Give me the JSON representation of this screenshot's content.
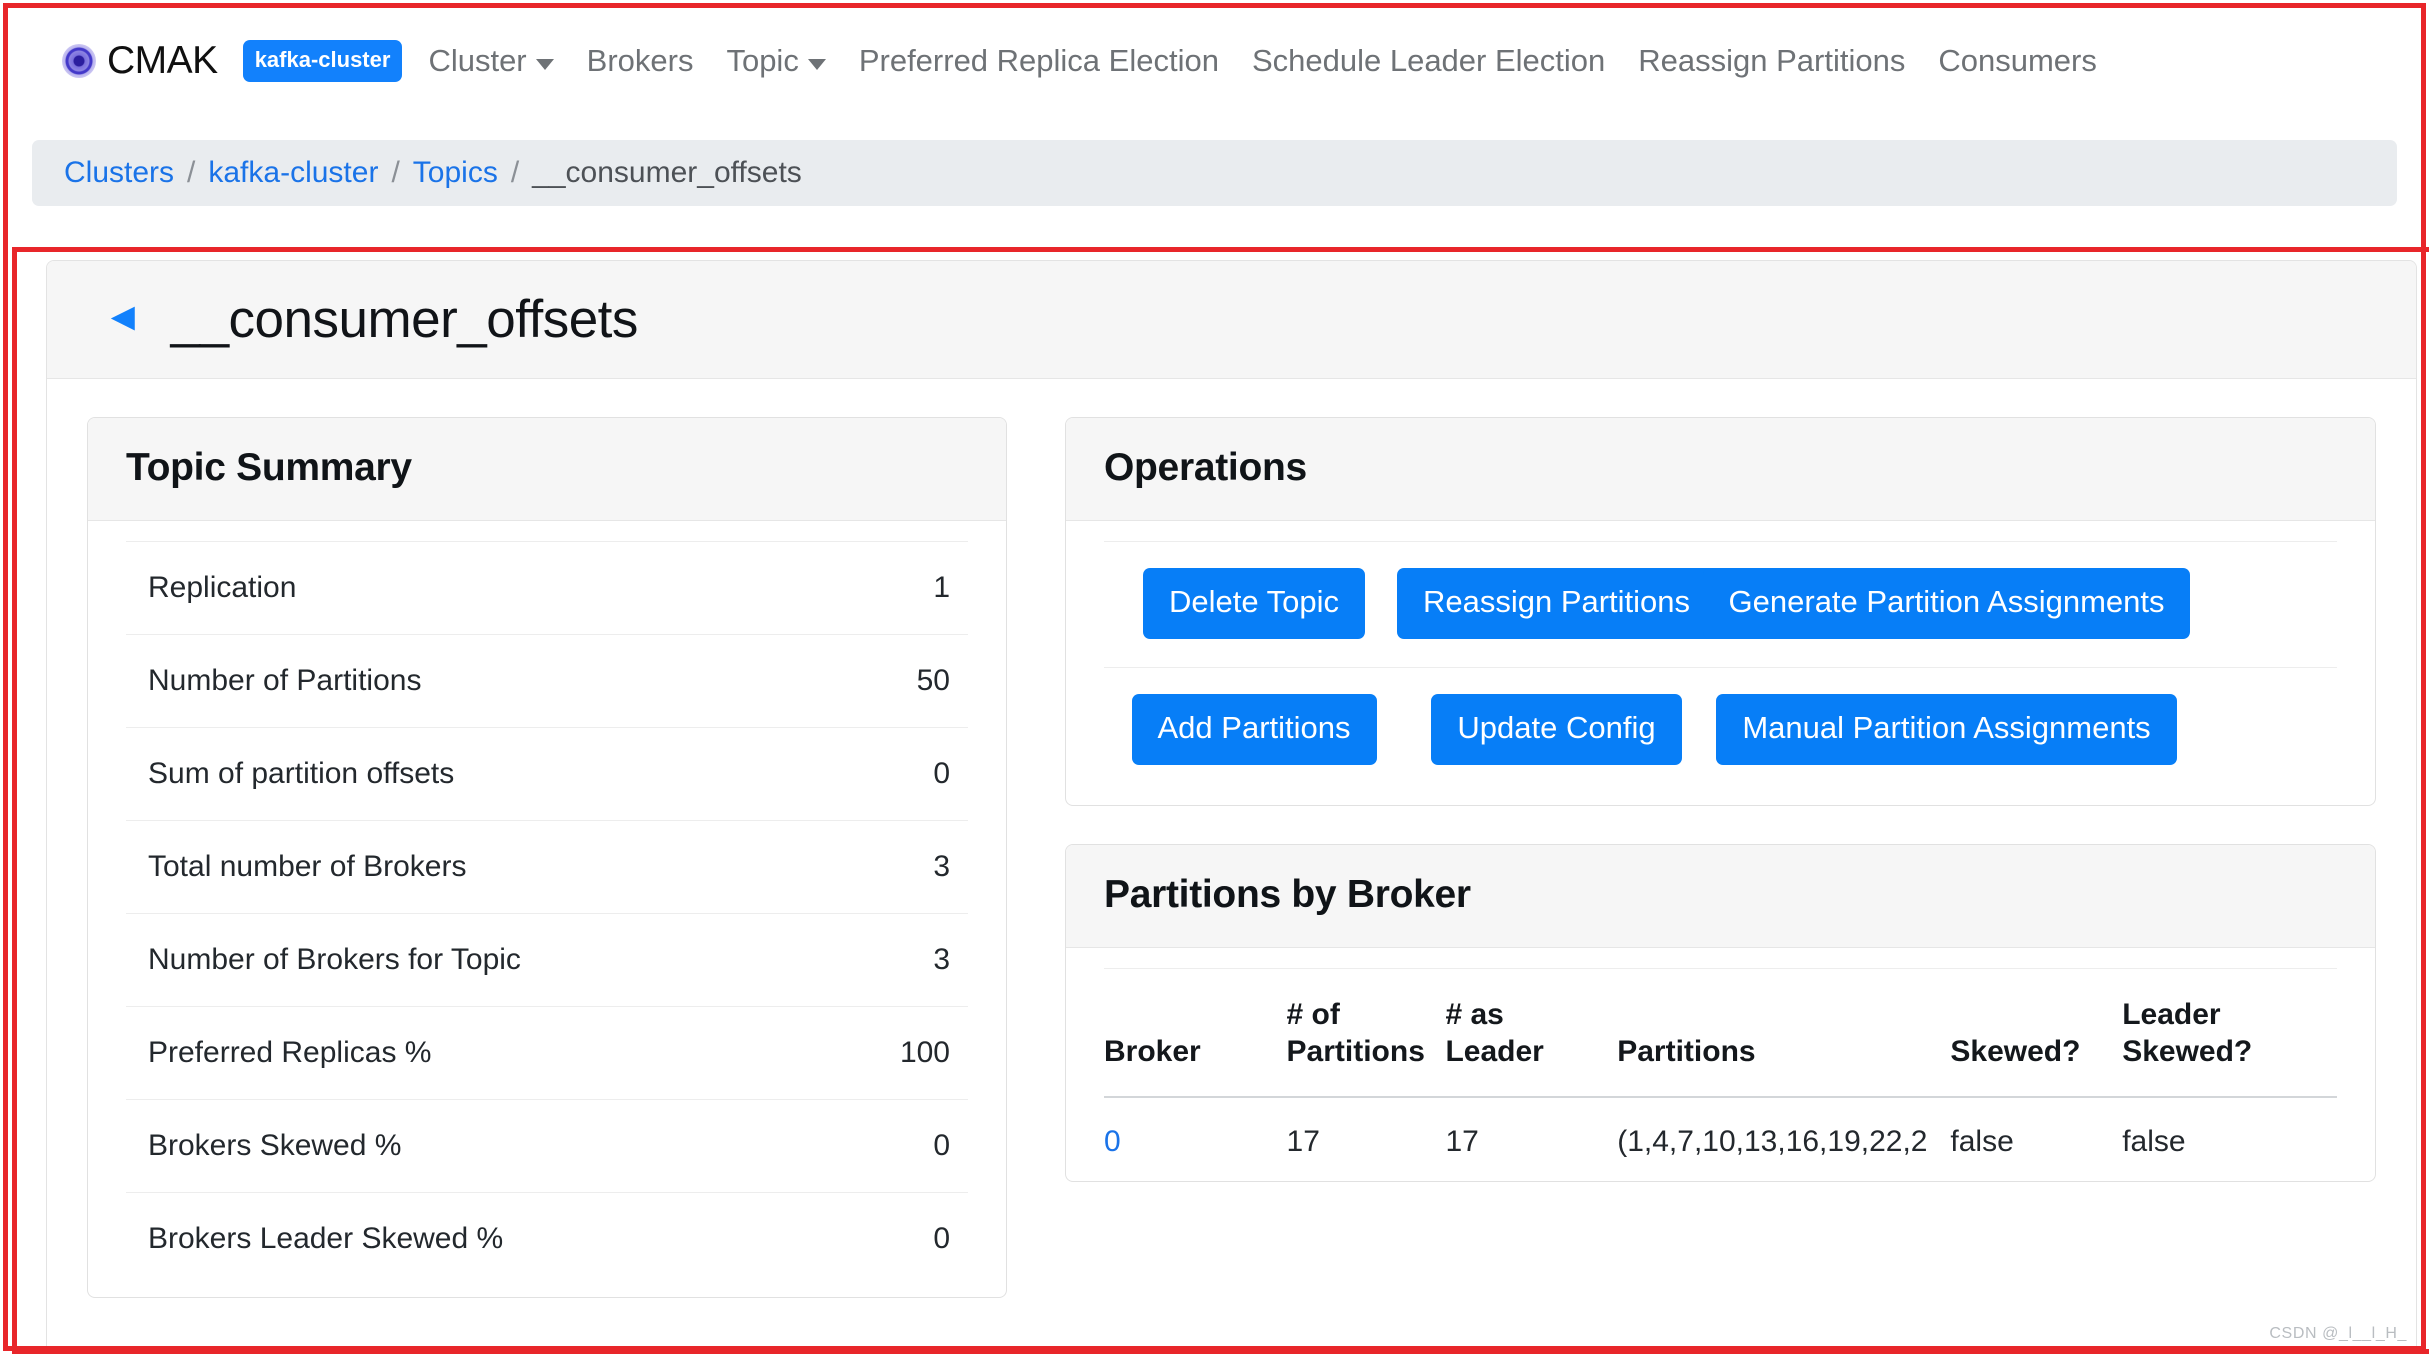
{
  "navbar": {
    "brand": "CMAK",
    "cluster_badge": "kafka-cluster",
    "links": [
      {
        "label": "Cluster",
        "caret": true
      },
      {
        "label": "Brokers",
        "caret": false
      },
      {
        "label": "Topic",
        "caret": true
      },
      {
        "label": "Preferred Replica Election",
        "caret": false
      },
      {
        "label": "Schedule Leader Election",
        "caret": false
      },
      {
        "label": "Reassign Partitions",
        "caret": false
      },
      {
        "label": "Consumers",
        "caret": false
      }
    ]
  },
  "breadcrumb": {
    "items": [
      "Clusters",
      "kafka-cluster",
      "Topics",
      "__consumer_offsets"
    ],
    "separator": "/"
  },
  "page": {
    "back_arrow": "◄",
    "title": "__consumer_offsets"
  },
  "topic_summary": {
    "title": "Topic Summary",
    "rows": [
      {
        "label": "Replication",
        "value": "1"
      },
      {
        "label": "Number of Partitions",
        "value": "50"
      },
      {
        "label": "Sum of partition offsets",
        "value": "0"
      },
      {
        "label": "Total number of Brokers",
        "value": "3"
      },
      {
        "label": "Number of Brokers for Topic",
        "value": "3"
      },
      {
        "label": "Preferred Replicas %",
        "value": "100"
      },
      {
        "label": "Brokers Skewed %",
        "value": "0"
      },
      {
        "label": "Brokers Leader Skewed %",
        "value": "0"
      }
    ]
  },
  "operations": {
    "title": "Operations",
    "row1": [
      "Delete Topic",
      "Reassign Partitions",
      "Generate Partition Assignments"
    ],
    "row2": [
      "Add Partitions",
      "Update Config",
      "Manual Partition Assignments"
    ]
  },
  "partitions_by_broker": {
    "title": "Partitions by Broker",
    "columns": [
      "Broker",
      "# of Partitions",
      "# as Leader",
      "Partitions",
      "Skewed?",
      "Leader Skewed?"
    ],
    "columns_wrapped": [
      {
        "l1": "",
        "l2": "Broker"
      },
      {
        "l1": "# of",
        "l2": "Partitions"
      },
      {
        "l1": "# as",
        "l2": "Leader"
      },
      {
        "l1": "",
        "l2": "Partitions"
      },
      {
        "l1": "",
        "l2": "Skewed?"
      },
      {
        "l1": "Leader",
        "l2": "Skewed?"
      }
    ],
    "rows": [
      {
        "broker": "0",
        "num_partitions": "17",
        "num_as_leader": "17",
        "partitions": "(1,4,7,10,13,16,19,22,2",
        "skewed": "false",
        "leader_skewed": "false"
      }
    ]
  },
  "watermark": "CSDN @_l__l_H_",
  "colors": {
    "accent_blue": "#077ef7",
    "link_blue": "#1a73e8",
    "badge_blue": "#1281fc",
    "annotation_red": "#e8262a",
    "panel_header_gray": "#f6f6f6",
    "breadcrumb_gray": "#e9ecef"
  }
}
